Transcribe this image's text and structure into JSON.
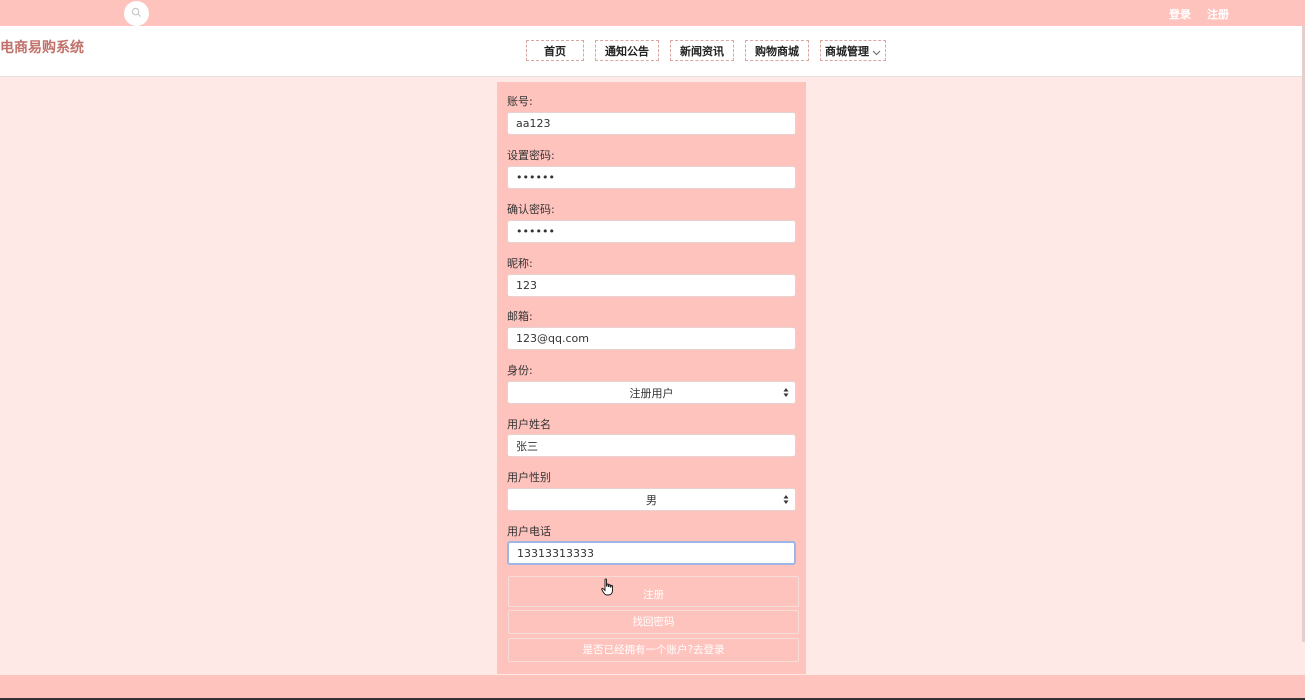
{
  "topbar": {
    "search_icon": "search-icon",
    "login_label": "登录",
    "register_label": "注册"
  },
  "header": {
    "brand": "电商易购系统",
    "nav": [
      {
        "label": "首页"
      },
      {
        "label": "通知公告"
      },
      {
        "label": "新闻资讯"
      },
      {
        "label": "购物商城"
      },
      {
        "label": "商城管理",
        "icon": "chevron-down-icon"
      }
    ]
  },
  "form": {
    "account": {
      "label": "账号:",
      "value": "aa123"
    },
    "password": {
      "label": "设置密码:",
      "value": "••••••"
    },
    "confirm_password": {
      "label": "确认密码:",
      "value": "••••••"
    },
    "nickname": {
      "label": "昵称:",
      "value": "123"
    },
    "email": {
      "label": "邮箱:",
      "value": "123@qq.com"
    },
    "role": {
      "label": "身份:",
      "value": "注册用户"
    },
    "user_name": {
      "label": "用户姓名",
      "value": "张三"
    },
    "user_gender": {
      "label": "用户性别",
      "value": "男"
    },
    "user_phone": {
      "label": "用户电话",
      "value": "13313313333"
    },
    "register_button": "注册",
    "forgot_button": "找回密码",
    "login_link": "是否已经拥有一个账户?去登录"
  },
  "colors": {
    "accent": "#ffc3bd",
    "page_bg": "#ffe9e7",
    "brand": "#c0726a"
  }
}
